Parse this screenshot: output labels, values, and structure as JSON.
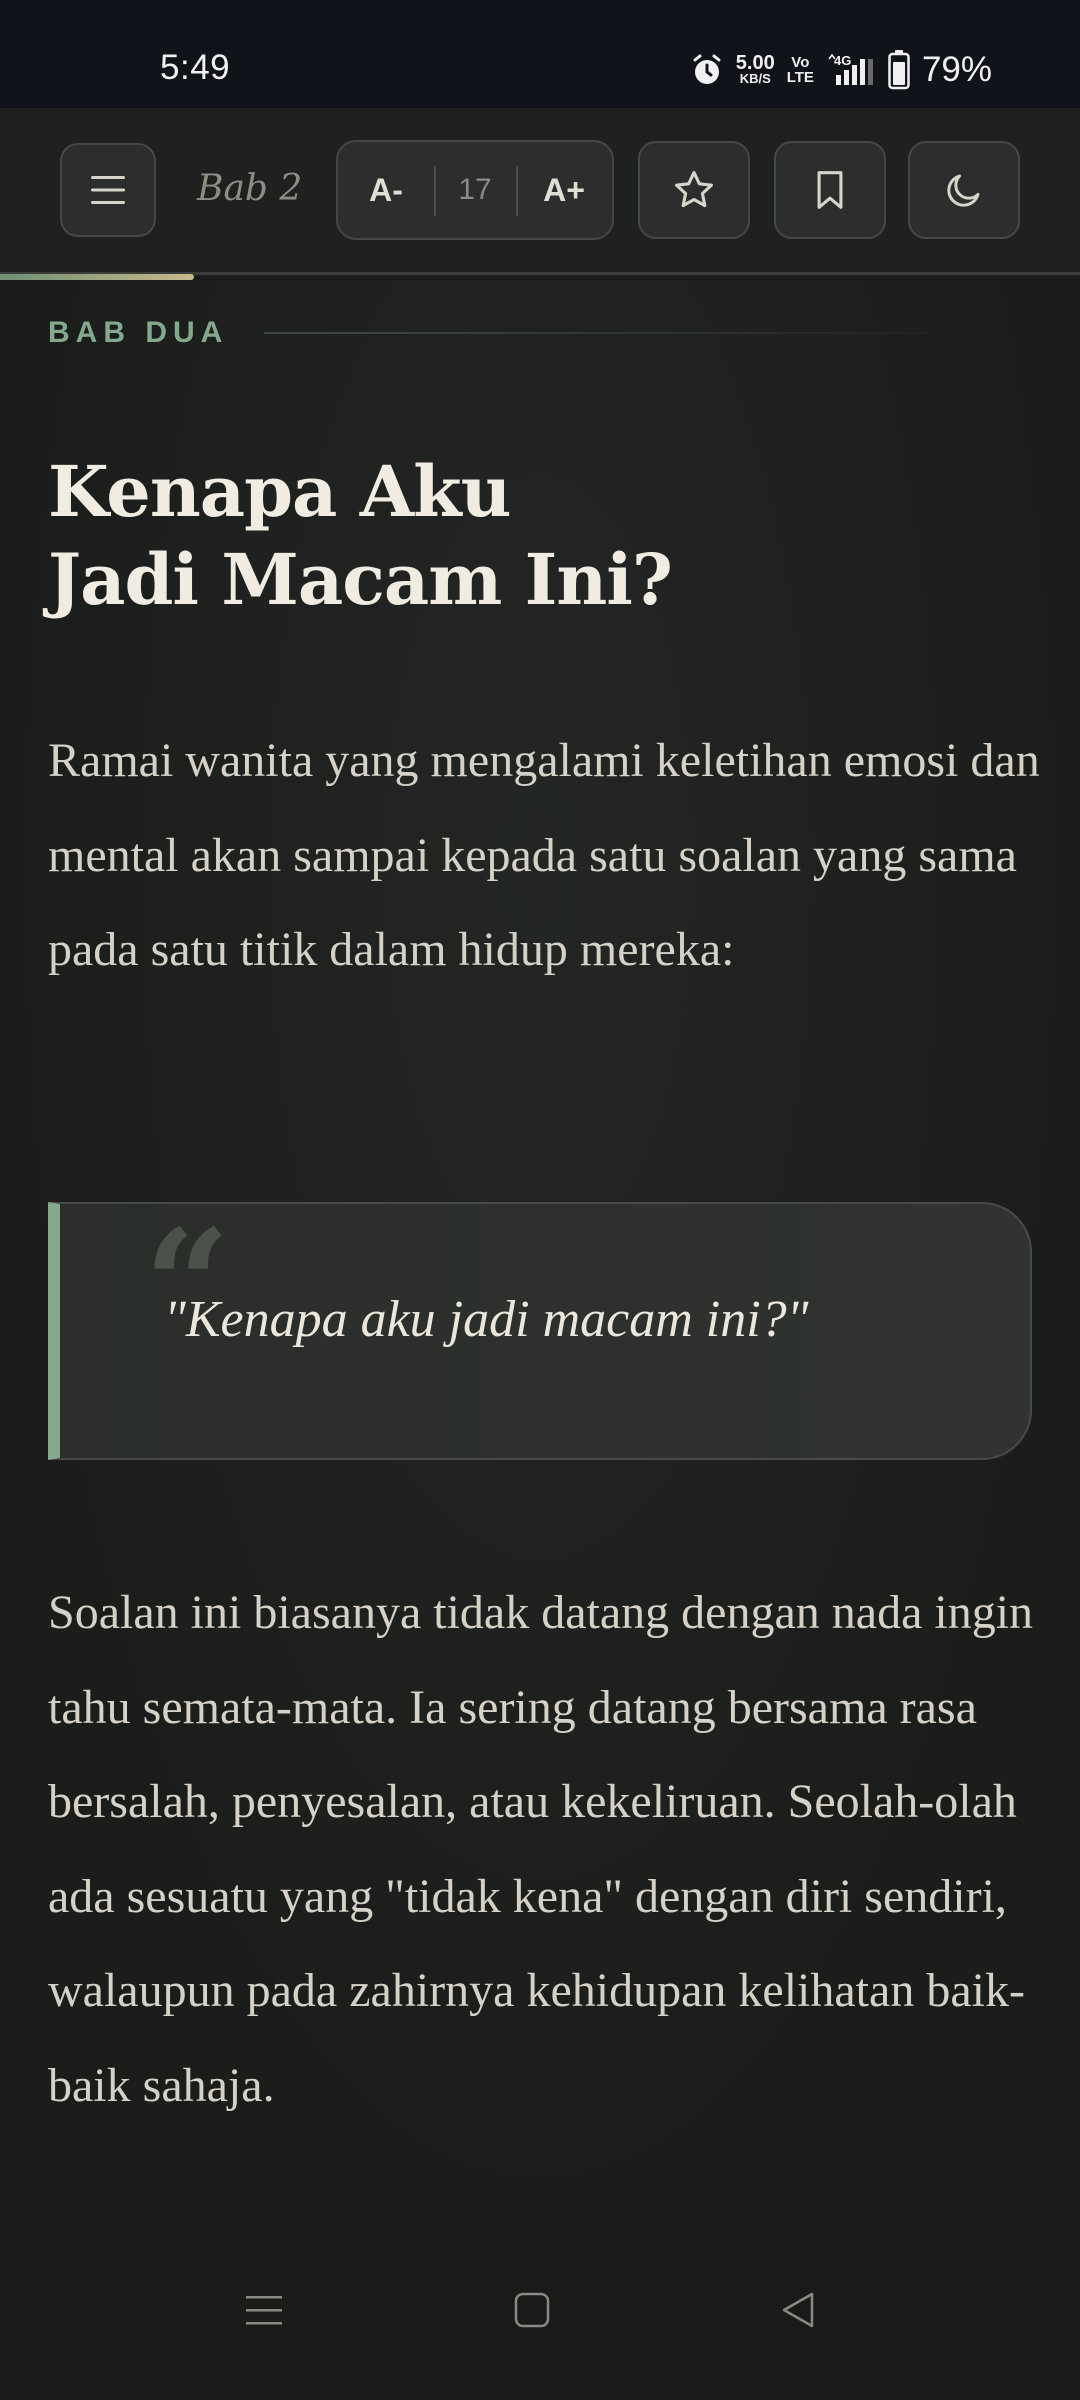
{
  "status_bar": {
    "time": "5:49",
    "speed_value": "5.00",
    "speed_unit": "KB/S",
    "volte_top": "Vo",
    "volte_bottom": "LTE",
    "network": "4G",
    "battery": "79%"
  },
  "toolbar": {
    "chapter_label": "Bab 2",
    "font_decrease": "A-",
    "font_size": "17",
    "font_increase": "A+",
    "reading_progress": 0.18
  },
  "content": {
    "kicker": "BAB DUA",
    "title_line1": "Kenapa Aku",
    "title_line2": "Jadi Macam Ini?",
    "paragraph1": "Ramai wanita yang mengalami keletihan emosi dan mental akan sampai kepada satu soalan yang sama pada satu titik dalam hidup mereka:",
    "quote": "\"Kenapa aku jadi macam ini?\"",
    "paragraph2": "Soalan ini biasanya tidak datang dengan nada ingin tahu semata-mata. Ia sering datang bersama rasa bersalah, penyesalan, atau kekeliruan. Seolah-olah ada sesuatu yang \"tidak kena\" dengan diri sendiri, walaupun pada zahirnya kehidupan kelihatan baik-baik sahaja."
  },
  "theme": {
    "accent": "#84a98c",
    "background": "#1b1d1b",
    "text": "#d6d1c6"
  },
  "icons": {
    "menu": "hamburger-icon",
    "star": "star-icon",
    "bookmark": "bookmark-icon",
    "night_mode": "moon-icon"
  }
}
